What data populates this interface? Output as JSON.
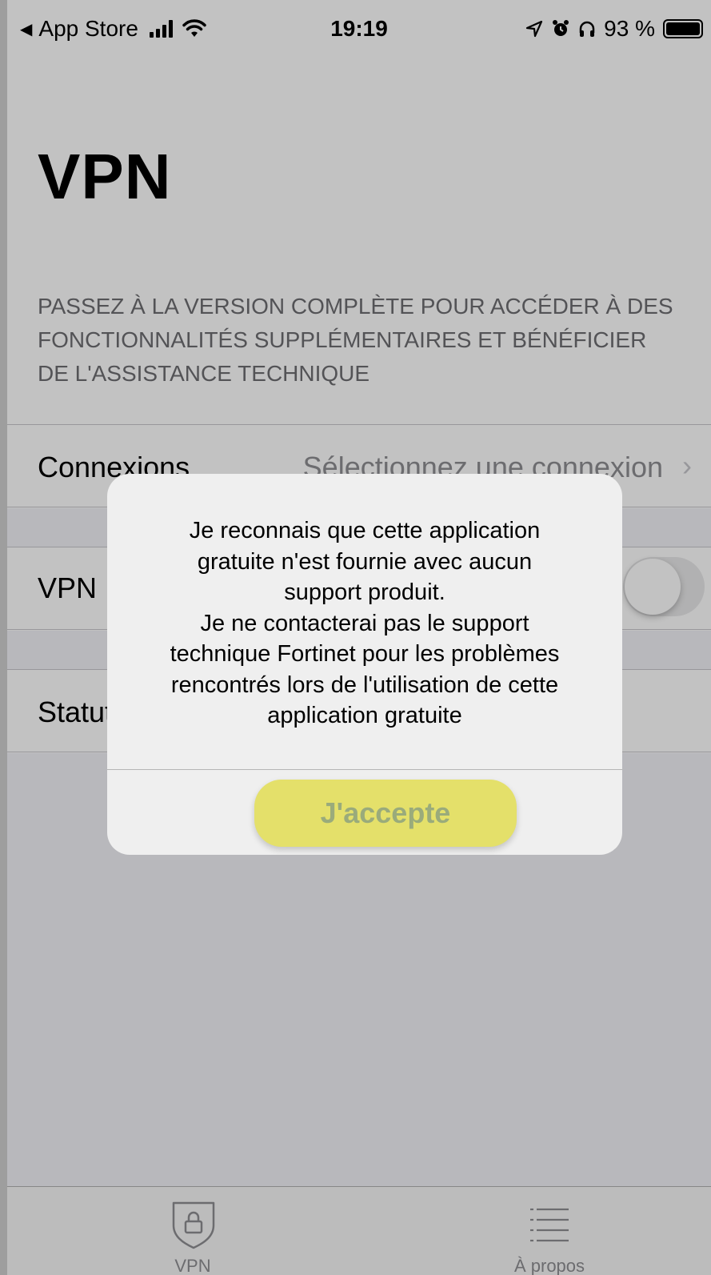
{
  "status_bar": {
    "back_label": "App Store",
    "time": "19:19",
    "battery": "93 %"
  },
  "page": {
    "title": "VPN",
    "promo": "PASSEZ À LA VERSION COMPLÈTE POUR ACCÉDER À DES FONCTIONNALITÉS SUPPLÉMENTAIRES ET BÉNÉFICIER DE L'ASSISTANCE TECHNIQUE"
  },
  "rows": {
    "connexions_label": "Connexions",
    "connexions_value": "Sélectionnez une connexion",
    "vpn_label": "VPN",
    "vpn_toggle_on": false,
    "status_label": "Statut"
  },
  "alert": {
    "lines": [
      "Je reconnais que cette application",
      "gratuite n'est fournie avec aucun",
      "support produit.",
      "Je ne contacterai pas le support",
      "technique Fortinet pour les problèmes",
      "rencontrés lors de l'utilisation de cette",
      "application gratuite"
    ],
    "accept_label": "J'accepte",
    "accept_color": "#e4e06a"
  },
  "tabbar": {
    "tabs": [
      {
        "label": "VPN",
        "icon": "shield-lock-icon"
      },
      {
        "label": "À propos",
        "icon": "list-icon"
      }
    ]
  }
}
